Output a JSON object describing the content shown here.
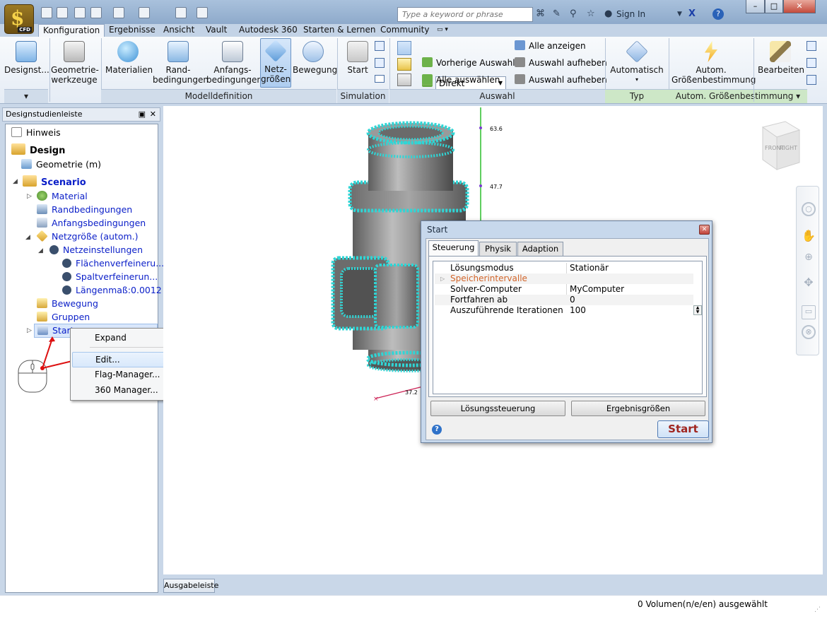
{
  "titlebar": {
    "app_badge": "CFD",
    "search_placeholder": "Type a keyword or phrase",
    "sign_in": "Sign In",
    "window_buttons": [
      "–",
      "□",
      "✕"
    ]
  },
  "tabs": [
    "Konfiguration",
    "Ergebnisse",
    "Ansicht",
    "Vault",
    "Autodesk 360",
    "Starten & Lernen",
    "Community"
  ],
  "active_tab": "Konfiguration",
  "ribbon": {
    "designstudien": "Designst...",
    "geometrie": [
      "Geometrie-",
      "werkzeuge"
    ],
    "materialien": "Materialien",
    "rand": [
      "Rand-",
      "bedingungen"
    ],
    "anfangs": [
      "Anfangs-",
      "bedingungen"
    ],
    "netz": [
      "Netz-",
      "größen"
    ],
    "bewegung": "Bewegung",
    "start": "Start",
    "direkt": "Direkt",
    "vorherige_auswahl": "Vorherige Auswahl",
    "alle_auswaehlen": "Alle auswählen",
    "alle_anzeigen": "Alle anzeigen",
    "auswahl_aufheben_1": "Auswahl aufheben",
    "auswahl_aufheben_2": "Auswahl aufheben",
    "automatisch": "Automatisch",
    "autom_groessen": [
      "Autom.",
      "Größenbestimmung"
    ],
    "bearbeiten": "Bearbeiten",
    "groups": {
      "modelldefinition": "Modelldefinition",
      "simulation": "Simulation",
      "auswahl": "Auswahl",
      "typ": "Typ",
      "autom": "Autom. Größenbestimmung"
    }
  },
  "panel": {
    "title": "Designstudienleiste",
    "tree": [
      {
        "label": "Hinweis"
      },
      {
        "label": "Design"
      },
      {
        "label": "Geometrie (m)"
      },
      {
        "label": "Scenario"
      },
      {
        "label": "Material"
      },
      {
        "label": "Randbedingungen"
      },
      {
        "label": "Anfangsbedingungen"
      },
      {
        "label": "Netzgröße (autom.)"
      },
      {
        "label": "Netzeinstellungen"
      },
      {
        "label": "Flächenverfeineru..."
      },
      {
        "label": "Spaltverfeinerun..."
      },
      {
        "label": "Längenmaß:0.0012"
      },
      {
        "label": "Bewegung"
      },
      {
        "label": "Gruppen"
      },
      {
        "label": "Start"
      }
    ]
  },
  "context_menu": [
    "Expand",
    "Edit...",
    "Flag-Manager...",
    "360 Manager..."
  ],
  "viewport": {
    "axis_labels": [
      "63.6",
      "47.7",
      "37.2"
    ],
    "viewcube": [
      "FRONT",
      "RIGHT"
    ]
  },
  "dialog": {
    "title": "Start",
    "tabs": [
      "Steuerung",
      "Physik",
      "Adaption"
    ],
    "rows": [
      {
        "key": "Lösungsmodus",
        "value": "Stationär"
      },
      {
        "key": "Speicherintervalle",
        "value": ""
      },
      {
        "key": "Solver-Computer",
        "value": "MyComputer"
      },
      {
        "key": "Fortfahren ab",
        "value": "0"
      },
      {
        "key": "Auszuführende Iterationen",
        "value": "100"
      }
    ],
    "btn_loesung": "Lösungssteuerung",
    "btn_ergebnis": "Ergebnisgrößen",
    "btn_start": "Start",
    "help": "?"
  },
  "output_button": "Ausgabeleiste",
  "status": "0 Volumen(n/e/en) ausgewählt",
  "colors": {
    "mesh_cyan": "#2fd6d6",
    "body_gray": "#8f8f8f",
    "link_blue": "#0a1ec8",
    "orange": "#d2652a"
  }
}
